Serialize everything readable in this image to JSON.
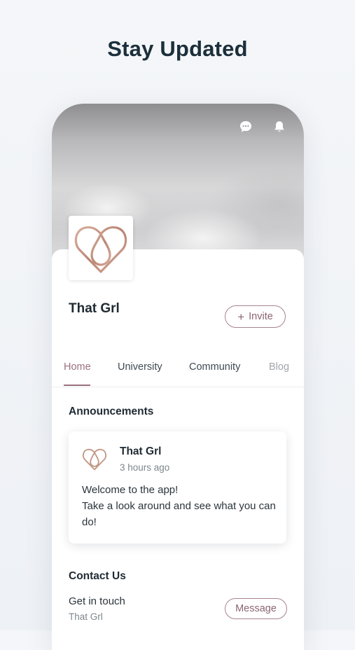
{
  "headline": "Stay Updated",
  "header": {
    "icons": [
      "chat-icon",
      "bell-icon"
    ]
  },
  "site": {
    "name": "That Grl",
    "invite_label": "Invite",
    "logo_icon": "heart-drop-logo"
  },
  "tabs": [
    {
      "label": "Home",
      "active": true
    },
    {
      "label": "University",
      "active": false
    },
    {
      "label": "Community",
      "active": false
    },
    {
      "label": "Blog",
      "active": false
    }
  ],
  "announcements": {
    "title": "Announcements",
    "post": {
      "author": "That Grl",
      "time": "3 hours ago",
      "line1": "Welcome to the app!",
      "line2": "Take a look around and see what you can do!"
    }
  },
  "contact": {
    "title": "Contact Us",
    "line1": "Get in touch",
    "line2": "That Grl",
    "button_label": "Message"
  },
  "colors": {
    "accent": "#9a6f7d",
    "logo_rose_gold": "#c79b8a",
    "heading": "#1c2f3b"
  }
}
